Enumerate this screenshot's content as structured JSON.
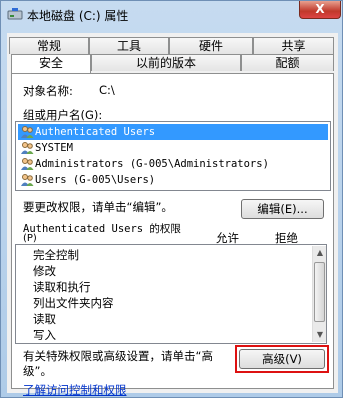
{
  "window": {
    "title": "本地磁盘 (C:) 属性",
    "close_label": "X"
  },
  "tabs_row1": [
    "常规",
    "工具",
    "硬件",
    "共享"
  ],
  "tabs_row2": [
    "安全",
    "以前的版本",
    "配额"
  ],
  "object": {
    "label": "对象名称:",
    "value": "C:\\"
  },
  "groups": {
    "label": "组或用户名(G):",
    "users": [
      "Authenticated Users",
      "SYSTEM",
      "Administrators (G-005\\Administrators)",
      "Users (G-005\\Users)"
    ]
  },
  "change_perm_text": "要更改权限，请单击“编辑”。",
  "edit_button": "编辑(E)...",
  "perm_header": {
    "title": "Authenticated Users 的权限",
    "accel": "(P)",
    "allow": "允许",
    "deny": "拒绝"
  },
  "permissions": [
    "完全控制",
    "修改",
    "读取和执行",
    "列出文件夹内容",
    "读取",
    "写入"
  ],
  "advanced": {
    "text_line1": "有关特殊权限或高级设置，请单击“高",
    "text_line2": "级”。",
    "button": "高级(V)"
  },
  "help_link": "了解访问控制和权限",
  "colors": {
    "selection": "#3399ff",
    "highlight_box": "#dd1111",
    "link": "#0033cc"
  }
}
